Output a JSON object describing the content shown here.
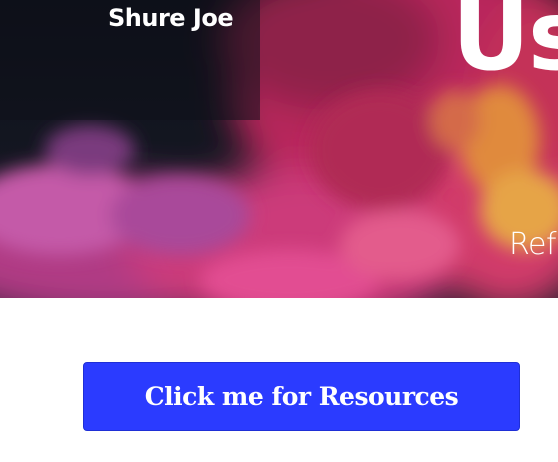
{
  "header": {
    "site_name": "Shure Joe"
  },
  "hero": {
    "heading": "Us",
    "subheading": "Refl",
    "background": "smoke-ink-image"
  },
  "cta": {
    "resources_label": "Click me for Resources"
  },
  "colors": {
    "button": "#2b3bff",
    "hero_dark": "#141823",
    "smoke_pink": "#d2336f",
    "smoke_orange": "#e8923a"
  }
}
